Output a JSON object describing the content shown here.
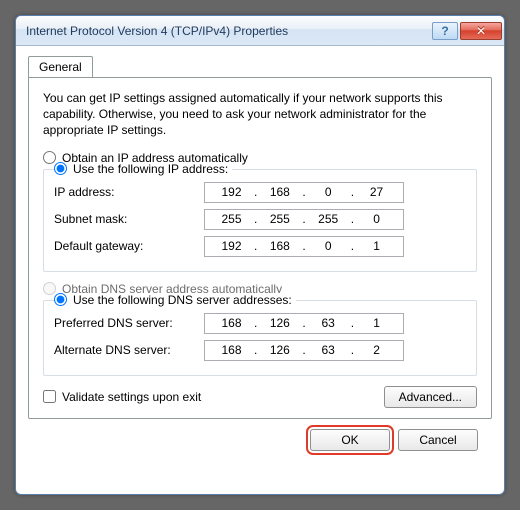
{
  "window": {
    "title": "Internet Protocol Version 4 (TCP/IPv4) Properties",
    "help": "?",
    "close": "✕"
  },
  "tab": {
    "general": "General"
  },
  "description": "You can get IP settings assigned automatically if your network supports this capability. Otherwise, you need to ask your network administrator for the appropriate IP settings.",
  "ip": {
    "obtain_auto": "Obtain an IP address automatically",
    "use_following": "Use the following IP address:",
    "address_label": "IP address:",
    "address": [
      "192",
      "168",
      "0",
      "27"
    ],
    "subnet_label": "Subnet mask:",
    "subnet": [
      "255",
      "255",
      "255",
      "0"
    ],
    "gateway_label": "Default gateway:",
    "gateway": [
      "192",
      "168",
      "0",
      "1"
    ]
  },
  "dns": {
    "obtain_auto": "Obtain DNS server address automatically",
    "use_following": "Use the following DNS server addresses:",
    "preferred_label": "Preferred DNS server:",
    "preferred": [
      "168",
      "126",
      "63",
      "1"
    ],
    "alternate_label": "Alternate DNS server:",
    "alternate": [
      "168",
      "126",
      "63",
      "2"
    ]
  },
  "validate_label": "Validate settings upon exit",
  "buttons": {
    "advanced": "Advanced...",
    "ok": "OK",
    "cancel": "Cancel"
  }
}
